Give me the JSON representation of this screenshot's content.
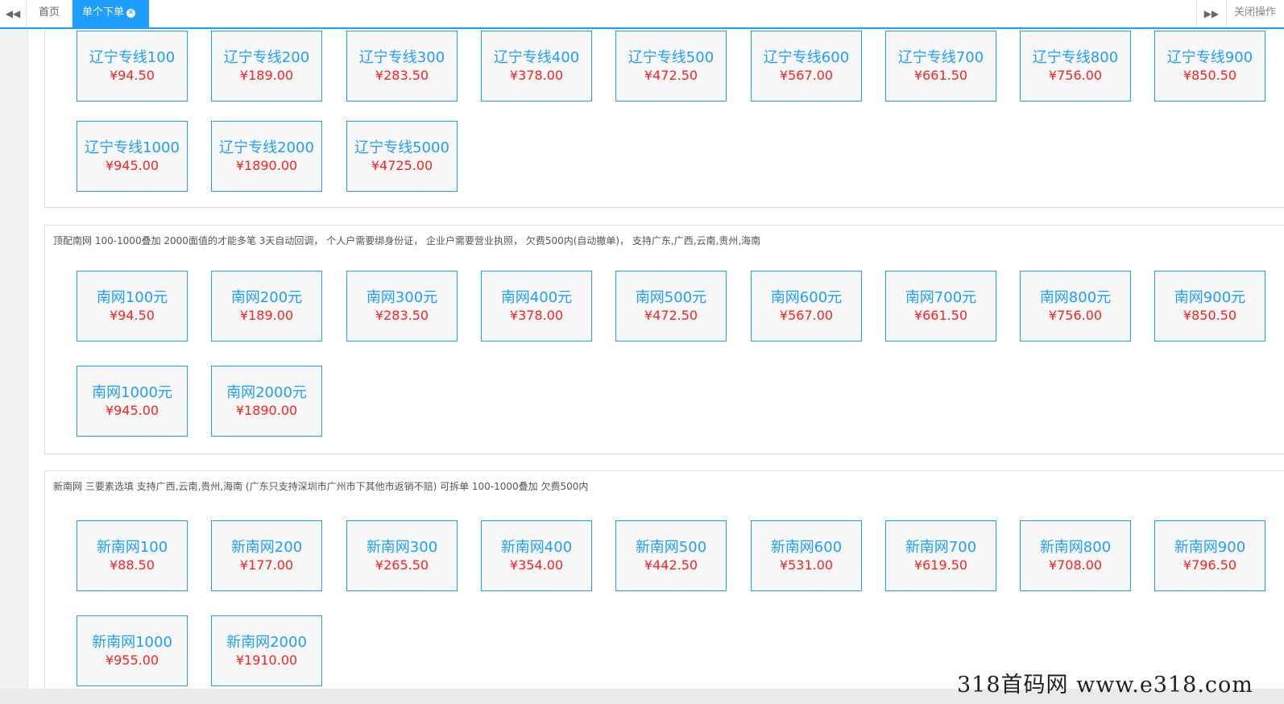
{
  "tabbar": {
    "left_arrow": "◀◀",
    "right_arrow": "▶▶",
    "home": "首页",
    "active_tab": "单个下单",
    "active_tab_close": "✕",
    "close_ops": "关闭操作"
  },
  "sections": [
    {
      "note": "",
      "rows": [
        [
          {
            "name": "辽宁专线100",
            "price": "¥94.50"
          },
          {
            "name": "辽宁专线200",
            "price": "¥189.00"
          },
          {
            "name": "辽宁专线300",
            "price": "¥283.50"
          },
          {
            "name": "辽宁专线400",
            "price": "¥378.00"
          },
          {
            "name": "辽宁专线500",
            "price": "¥472.50"
          },
          {
            "name": "辽宁专线600",
            "price": "¥567.00"
          },
          {
            "name": "辽宁专线700",
            "price": "¥661.50"
          },
          {
            "name": "辽宁专线800",
            "price": "¥756.00"
          },
          {
            "name": "辽宁专线900",
            "price": "¥850.50"
          }
        ],
        [
          {
            "name": "辽宁专线1000",
            "price": "¥945.00"
          },
          {
            "name": "辽宁专线2000",
            "price": "¥1890.00"
          },
          {
            "name": "辽宁专线5000",
            "price": "¥4725.00"
          }
        ]
      ]
    },
    {
      "note": "顶配南网 100-1000叠加 2000面值的才能多笔 3天自动回调， 个人户需要绑身份证， 企业户需要营业执照， 欠费500内(自动撤单)， 支持广东,广西,云南,贵州,海南",
      "rows": [
        [
          {
            "name": "南网100元",
            "price": "¥94.50"
          },
          {
            "name": "南网200元",
            "price": "¥189.00"
          },
          {
            "name": "南网300元",
            "price": "¥283.50"
          },
          {
            "name": "南网400元",
            "price": "¥378.00"
          },
          {
            "name": "南网500元",
            "price": "¥472.50"
          },
          {
            "name": "南网600元",
            "price": "¥567.00"
          },
          {
            "name": "南网700元",
            "price": "¥661.50"
          },
          {
            "name": "南网800元",
            "price": "¥756.00"
          },
          {
            "name": "南网900元",
            "price": "¥850.50"
          }
        ],
        [
          {
            "name": "南网1000元",
            "price": "¥945.00"
          },
          {
            "name": "南网2000元",
            "price": "¥1890.00"
          }
        ]
      ]
    },
    {
      "note": "新南网 三要素选填 支持广西,云南,贵州,海南 (广东只支持深圳市广州市下其他市返销不赔) 可拆单 100-1000叠加 欠费500内",
      "rows": [
        [
          {
            "name": "新南网100",
            "price": "¥88.50"
          },
          {
            "name": "新南网200",
            "price": "¥177.00"
          },
          {
            "name": "新南网300",
            "price": "¥265.50"
          },
          {
            "name": "新南网400",
            "price": "¥354.00"
          },
          {
            "name": "新南网500",
            "price": "¥442.50"
          },
          {
            "name": "新南网600",
            "price": "¥531.00"
          },
          {
            "name": "新南网700",
            "price": "¥619.50"
          },
          {
            "name": "新南网800",
            "price": "¥708.00"
          },
          {
            "name": "新南网900",
            "price": "¥796.50"
          }
        ],
        [
          {
            "name": "新南网1000",
            "price": "¥955.00"
          },
          {
            "name": "新南网2000",
            "price": "¥1910.00"
          }
        ]
      ]
    }
  ],
  "watermark": "318首码网  www.e318.com"
}
